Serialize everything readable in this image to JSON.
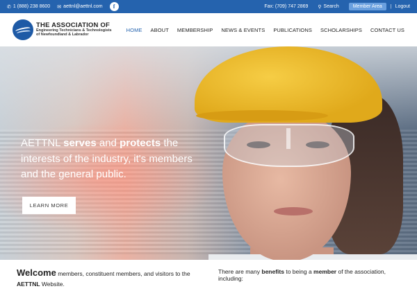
{
  "topbar": {
    "phone": "1 (888) 238 8600",
    "email": "aettnl@aettnl.com",
    "facebook": "f",
    "fax": "Fax: (709) 747 2869",
    "search_label": "Search",
    "member_area": "Member Area",
    "separator": "|",
    "logout": "Logout",
    "colors": {
      "bar": "#2563ae",
      "member_button": "#6aa0df"
    }
  },
  "header": {
    "logo_line1": "THE ASSOCIATION OF",
    "logo_line2": "Engineering Technicians & Technologists",
    "logo_line3": "of Newfoundland & Labrador",
    "nav": [
      {
        "label": "HOME",
        "active": true
      },
      {
        "label": "ABOUT"
      },
      {
        "label": "MEMBERSHIP"
      },
      {
        "label": "NEWS & EVENTS"
      },
      {
        "label": "PUBLICATIONS"
      },
      {
        "label": "SCHOLARSHIPS"
      },
      {
        "label": "CONTACT US"
      }
    ]
  },
  "hero": {
    "text_part1": "AETTNL ",
    "text_bold1": "serves",
    "text_part2": " and ",
    "text_bold2": "protects",
    "text_part3": " the interests of the industry, it's members and the general public.",
    "button": "LEARN MORE"
  },
  "content": {
    "welcome_big": "Welcome",
    "welcome_text1": " members, constituent members, and visitors to the ",
    "welcome_bold": "AETTNL",
    "welcome_text2": " Website.",
    "benefits_text1": "There are many ",
    "benefits_bold1": "benefits",
    "benefits_text2": " to being a ",
    "benefits_bold2": "member",
    "benefits_text3": " of the association, including:"
  }
}
